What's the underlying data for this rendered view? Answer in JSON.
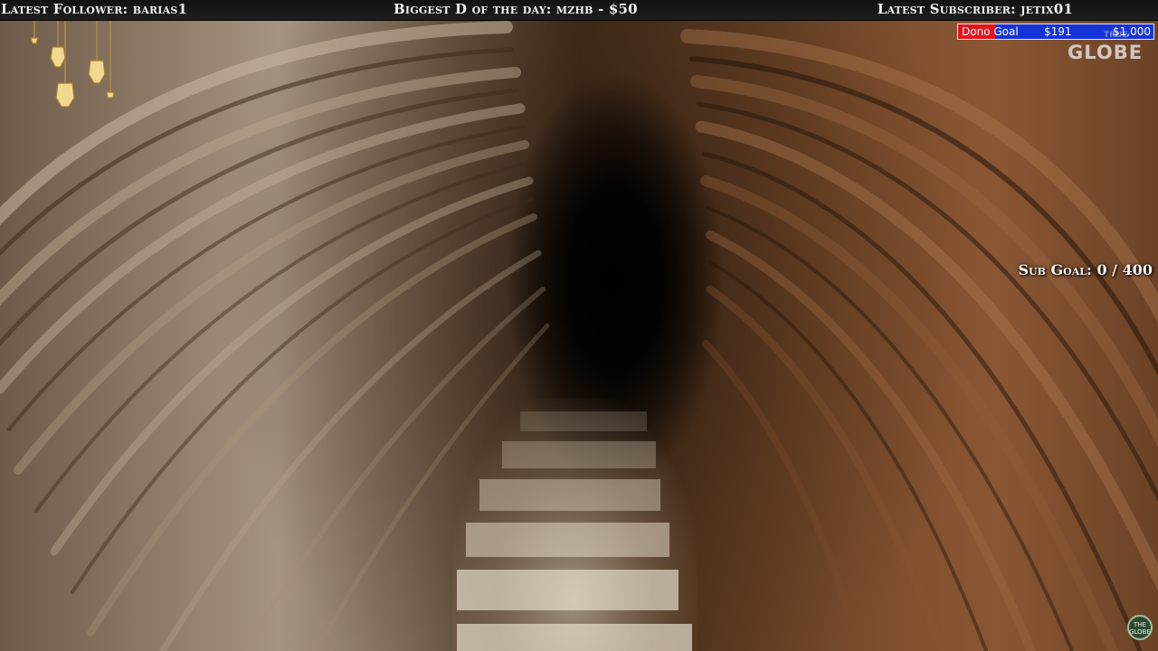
{
  "topbar": {
    "latest_follower_label": "Latest Follower: barias1",
    "biggest_donation_label": "Biggest D of the day: mzhb - $50",
    "latest_subscriber_label": "Latest Subscriber: jetix01"
  },
  "dono_goal": {
    "label": "Dono Goal",
    "current": "$191",
    "target": "$1,000",
    "progress_fraction": 0.191,
    "fill_color": "#e8121b",
    "bar_color": "#1534d8"
  },
  "channel_logo": {
    "text": "GLOBE",
    "small_text": "TRUE"
  },
  "sub_goal": {
    "label": "Sub Goal: 0 / 400"
  },
  "corner_badge": {
    "text": "THE GLOBE"
  },
  "decor": {
    "lantern_icon": "hanging-lanterns-icon"
  }
}
